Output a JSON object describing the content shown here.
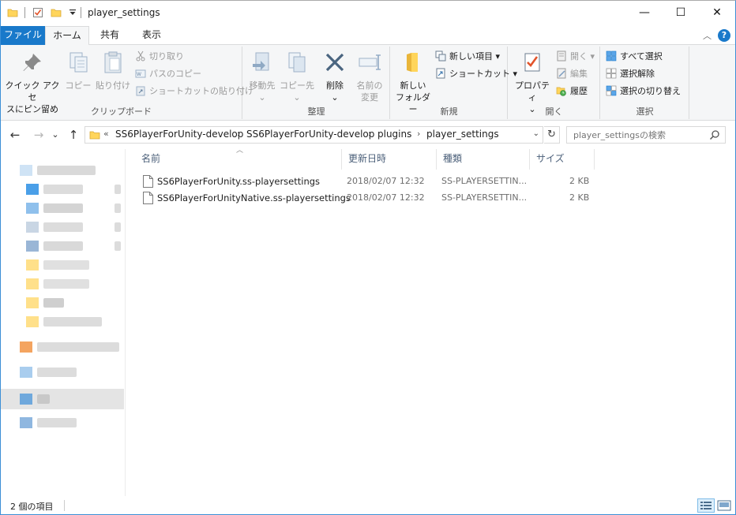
{
  "window": {
    "title": "player_settings",
    "controls": {
      "minimize": "—",
      "maximize": "☐",
      "close": "✕"
    }
  },
  "tabs": [
    {
      "label": "ファイル"
    },
    {
      "label": "ホーム"
    },
    {
      "label": "共有"
    },
    {
      "label": "表示"
    }
  ],
  "help_label": "?",
  "ribbon": {
    "clipboard": {
      "group_label": "クリップボード",
      "pin_label_1": "クイック アクセ",
      "pin_label_2": "スにピン留め",
      "copy_label": "コピー",
      "paste_label": "貼り付け",
      "cut_label": "切り取り",
      "copy_path_label": "パスのコピー",
      "paste_shortcut_label": "ショートカットの貼り付け"
    },
    "organize": {
      "group_label": "整理",
      "move_to_label": "移動先",
      "copy_to_label": "コピー先",
      "delete_label": "削除",
      "rename_label_1": "名前の",
      "rename_label_2": "変更"
    },
    "new": {
      "group_label": "新規",
      "new_folder_label_1": "新しい",
      "new_folder_label_2": "フォルダー",
      "new_item_label": "新しい項目 ▾",
      "shortcut_label": "ショートカット ▾"
    },
    "open": {
      "group_label": "開く",
      "properties_label": "プロパティ",
      "open_label": "開く ▾",
      "edit_label": "編集",
      "history_label": "履歴"
    },
    "select": {
      "group_label": "選択",
      "select_all_label": "すべて選択",
      "select_none_label": "選択解除",
      "invert_label": "選択の切り替え"
    }
  },
  "address": {
    "overflow": "«",
    "breadcrumbs": [
      "SS6PlayerForUnity-develop",
      "SS6PlayerForUnity-develop",
      "plugins",
      "player_settings"
    ],
    "separator": "›",
    "dropdown": "⌄",
    "refresh": "↻"
  },
  "nav": {
    "back": "←",
    "forward": "→",
    "recent": "⌄",
    "up": "↑"
  },
  "search": {
    "placeholder": "player_settingsの検索"
  },
  "columns": {
    "name": "名前",
    "date": "更新日時",
    "type": "種類",
    "size": "サイズ"
  },
  "files": [
    {
      "name": "SS6PlayerForUnity.ss-playersettings",
      "date": "2018/02/07 12:32",
      "type": "SS-PLAYERSETTIN...",
      "size": "2 KB"
    },
    {
      "name": "SS6PlayerForUnityNative.ss-playersettings",
      "date": "2018/02/07 12:32",
      "type": "SS-PLAYERSETTIN...",
      "size": "2 KB"
    }
  ],
  "status": {
    "item_count": "2 個の項目"
  },
  "colors": {
    "accent": "#1979ca",
    "ribbon_bg": "#f5f6f7",
    "header_text": "#4c607a",
    "folder_yellow": "#ffd55b",
    "selection": "#cce8ff"
  }
}
